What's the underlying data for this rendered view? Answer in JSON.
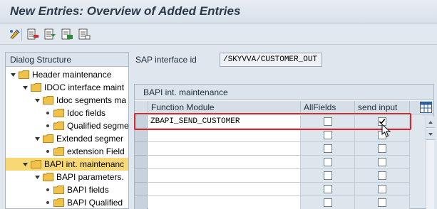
{
  "window": {
    "title": "New Entries: Overview of Added Entries"
  },
  "toolbar": {
    "buttons": [
      {
        "icon": "display-change-icon"
      },
      {
        "icon": "delete-icon"
      },
      {
        "icon": "select-all-icon"
      },
      {
        "icon": "select-block-icon"
      },
      {
        "icon": "deselect-all-icon"
      }
    ]
  },
  "dialog_structure": {
    "title": "Dialog Structure",
    "items": [
      {
        "label": "Header maintenance",
        "level": 0,
        "expanded": true
      },
      {
        "label": "IDOC interface maint",
        "level": 1,
        "expanded": true
      },
      {
        "label": "Idoc segments ma",
        "level": 2,
        "expanded": true
      },
      {
        "label": "Idoc fields",
        "level": 3
      },
      {
        "label": "Qualified segme",
        "level": 3
      },
      {
        "label": "Extended segmer",
        "level": 2,
        "expanded": true
      },
      {
        "label": "extension Field",
        "level": 3
      },
      {
        "label": "BAPI int. maintenanc",
        "level": 1,
        "expanded": true,
        "selected": true
      },
      {
        "label": "BAPI parameters.",
        "level": 2,
        "expanded": true
      },
      {
        "label": "BAPI fields",
        "level": 3
      },
      {
        "label": "BAPI Qualified",
        "level": 3
      }
    ]
  },
  "main": {
    "interface_label": "SAP interface id",
    "interface_value": "/SKYVVA/CUSTOMER_OUT",
    "table": {
      "title": "BAPI int. maintenance",
      "columns": [
        "Function Module",
        "AllFields",
        "send input"
      ],
      "rows": [
        {
          "function_module": "ZBAPI_SEND_CUSTOMER",
          "allfields": false,
          "send_input": true
        },
        {
          "function_module": "",
          "allfields": false,
          "send_input": false
        },
        {
          "function_module": "",
          "allfields": false,
          "send_input": false
        },
        {
          "function_module": "",
          "allfields": false,
          "send_input": false
        },
        {
          "function_module": "",
          "allfields": false,
          "send_input": false
        },
        {
          "function_module": "",
          "allfields": false,
          "send_input": false
        },
        {
          "function_module": "",
          "allfields": false,
          "send_input": false
        }
      ]
    }
  },
  "colors": {
    "highlight": "#d9282d",
    "selected_row": "#f7d874",
    "folder": "#f0c24a"
  }
}
